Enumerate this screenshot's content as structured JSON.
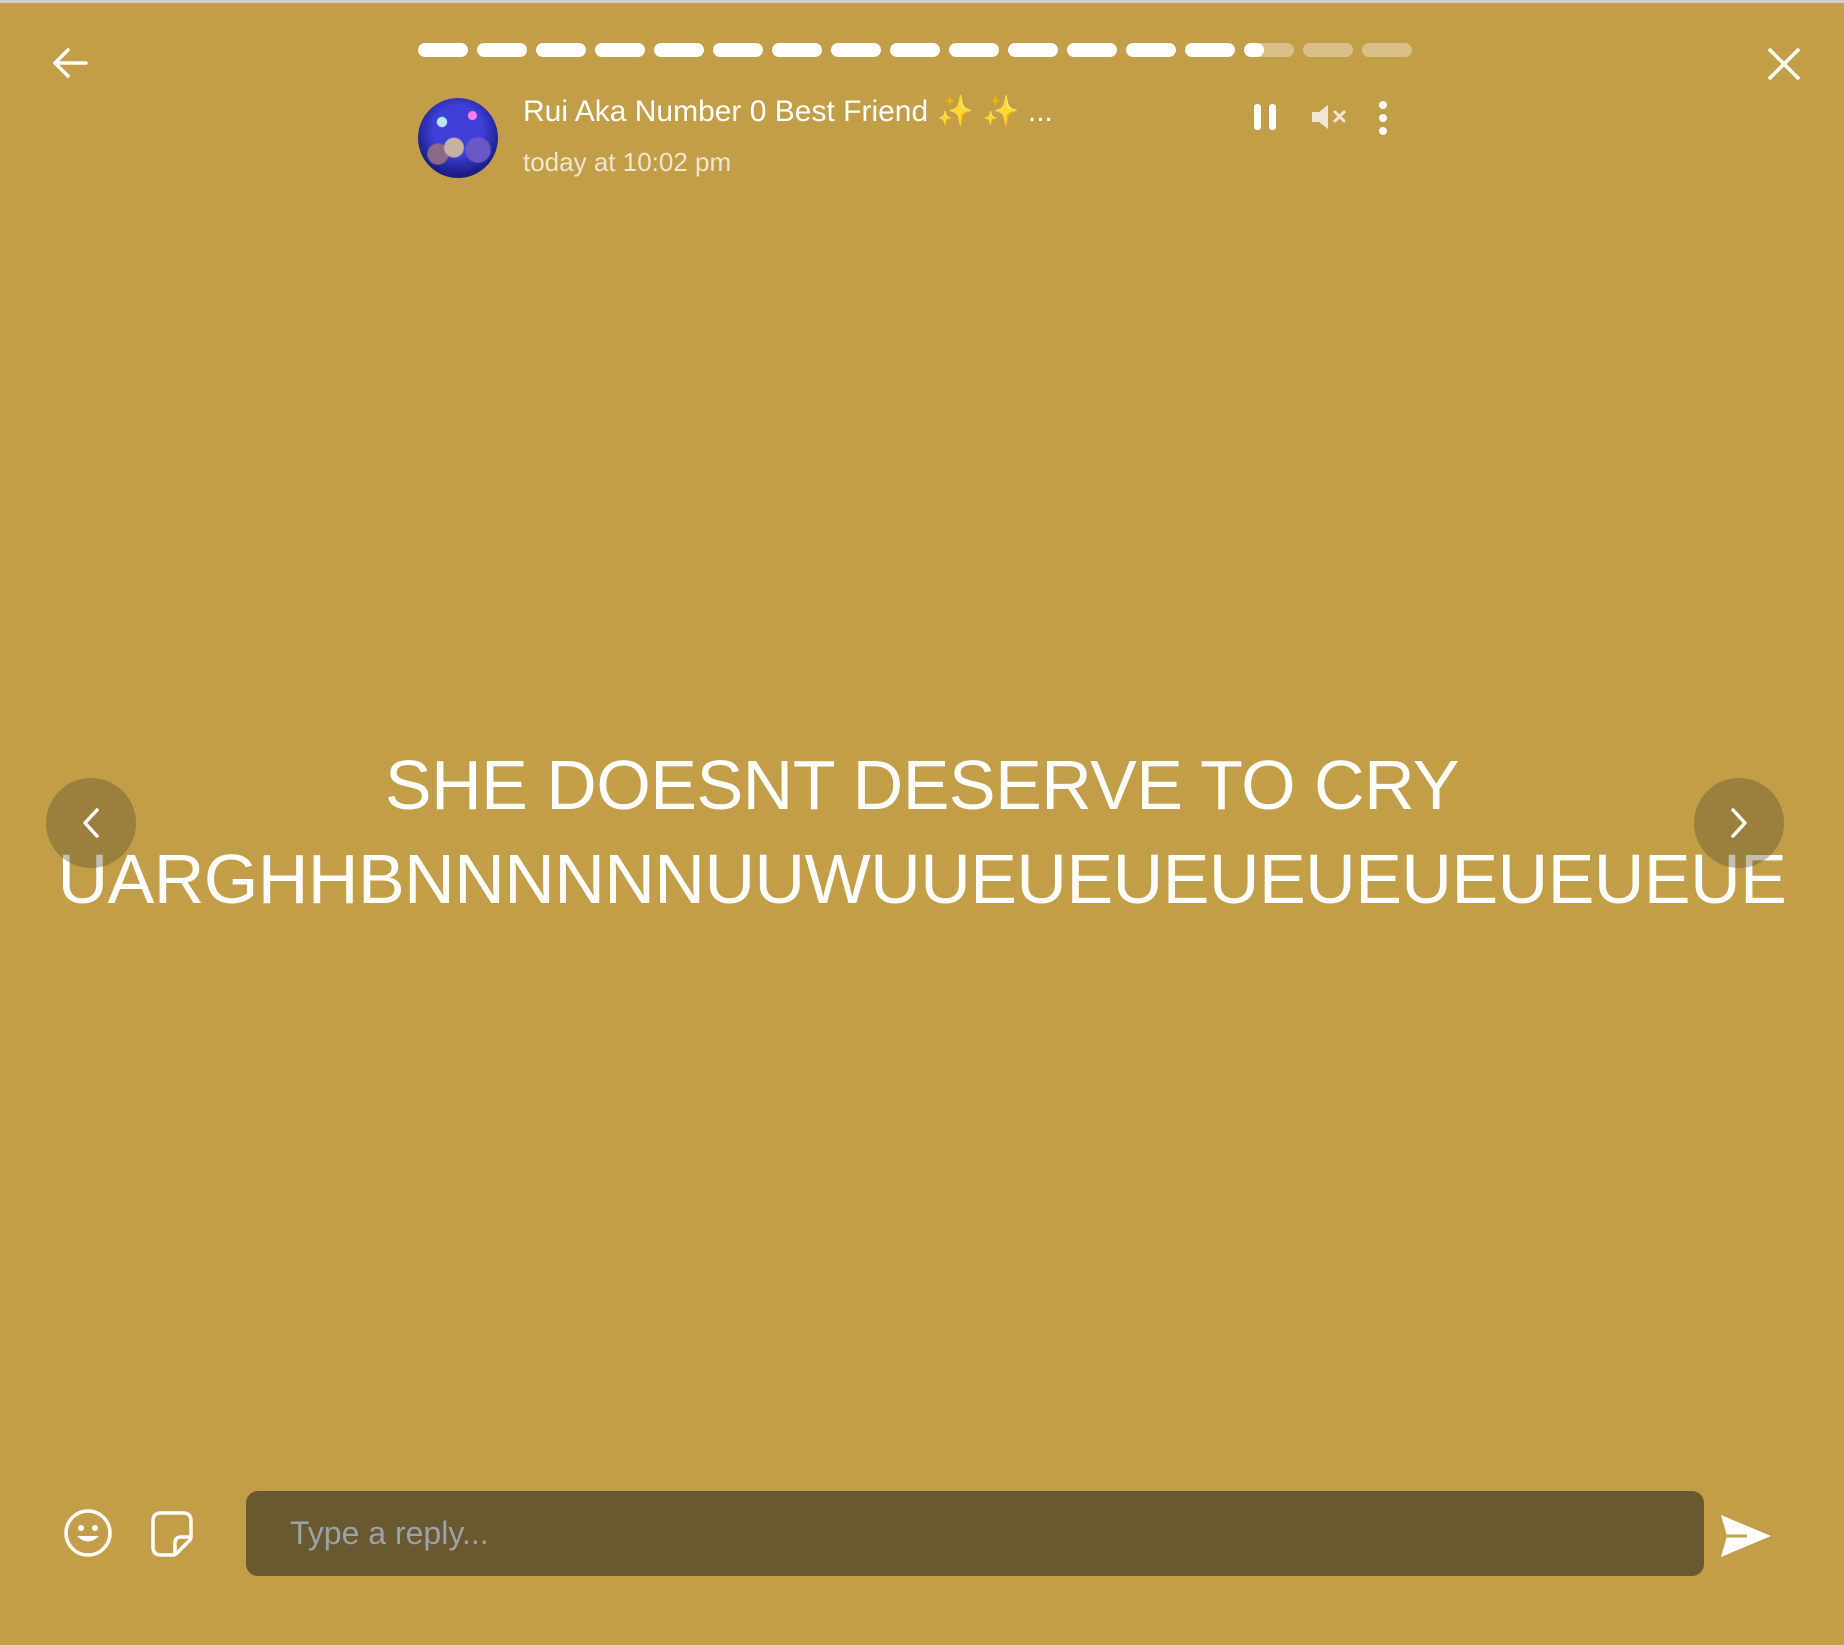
{
  "header": {
    "back_icon": "arrow-left-icon",
    "close_icon": "close-icon",
    "progress": {
      "total_segments": 17,
      "completed_segments": 14,
      "current_segment_fill": 0.4
    }
  },
  "author": {
    "name": "Rui Aka Number 0 Best Friend ✨ ✨ ...",
    "timestamp": "today at 10:02 pm"
  },
  "controls": {
    "pause_icon": "pause-icon",
    "mute_icon": "volume-muted-icon",
    "more_icon": "more-vertical-icon"
  },
  "story": {
    "line1": "SHE DOESNT DESERVE TO CRY",
    "line2": "UARGHHBNNNNNNUUWUUEUEUEUEUEUEUEUEUE",
    "background_color": "#c39e48",
    "text_color": "#ffffff"
  },
  "navigation": {
    "prev_icon": "chevron-left-icon",
    "next_icon": "chevron-right-icon"
  },
  "reply": {
    "placeholder": "Type a reply...",
    "emoji_icon": "smiley-icon",
    "sticker_icon": "sticker-icon",
    "send_icon": "send-icon"
  }
}
